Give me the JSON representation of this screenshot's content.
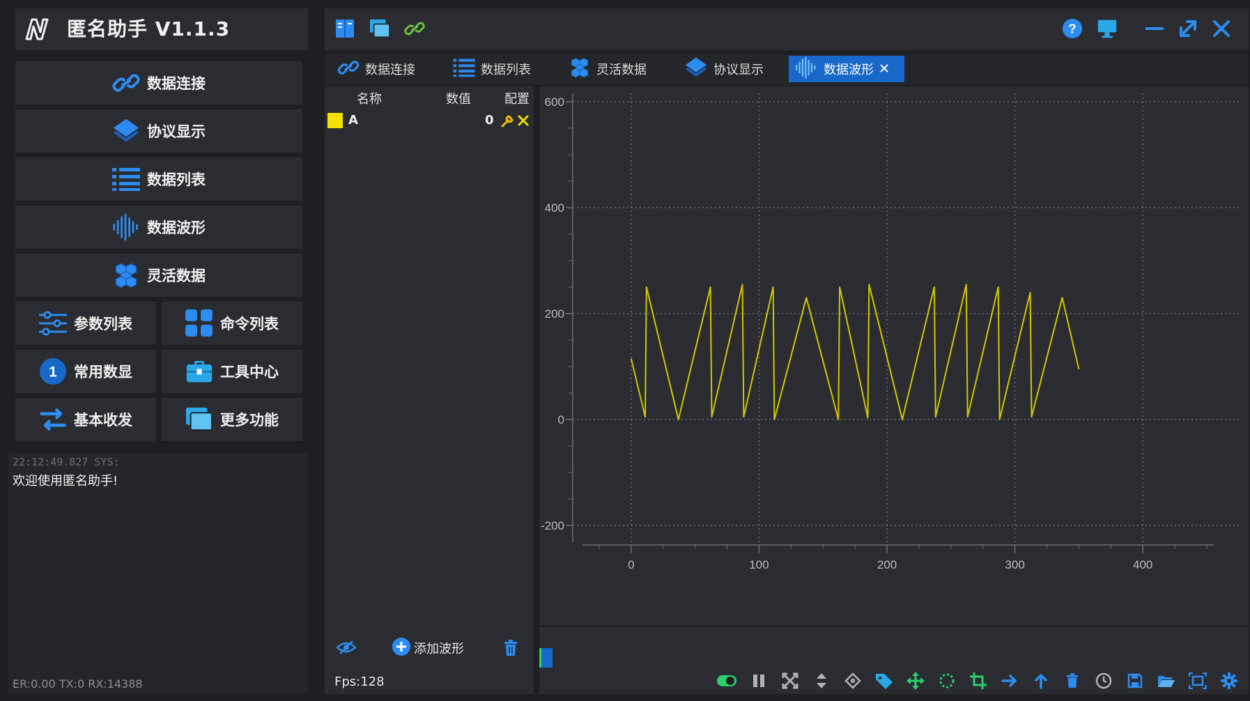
{
  "app": {
    "title": "匿名助手   V1.1.3"
  },
  "nav": {
    "connect": "数据连接",
    "protocol": "协议显示",
    "list": "数据列表",
    "waveform": "数据波形",
    "flex": "灵活数据",
    "params": "参数列表",
    "commands": "命令列表",
    "numeric": "常用数显",
    "numeric_badge": "1",
    "tools": "工具中心",
    "basic": "基本收发",
    "more": "更多功能"
  },
  "log": {
    "time": "22:12:49.827 SYS:",
    "message": "欢迎使用匿名助手!"
  },
  "status": {
    "text": "ER:0.00 TX:0 RX:14388"
  },
  "tabs": [
    {
      "label": "数据连接",
      "icon": "link-icon"
    },
    {
      "label": "数据列表",
      "icon": "list-icon"
    },
    {
      "label": "灵活数据",
      "icon": "cubes-icon"
    },
    {
      "label": "协议显示",
      "icon": "layers-icon"
    },
    {
      "label": "数据波形",
      "icon": "waveform-icon",
      "active": true
    }
  ],
  "series_table": {
    "headers": {
      "name": "名称",
      "value": "数值",
      "config": "配置"
    },
    "rows": [
      {
        "name": "A",
        "value": "0",
        "color": "#f5e000"
      }
    ]
  },
  "series_panel": {
    "add_label": "添加波形",
    "fps": "Fps:128"
  },
  "colors": {
    "accent": "#1868c9",
    "wave": "#d4c700",
    "background": "#1d1f23",
    "panel": "#2a2c31"
  },
  "chart_data": {
    "type": "line",
    "xlim": [
      -50,
      450
    ],
    "ylim": [
      -250,
      620
    ],
    "x_ticks": [
      0,
      100,
      200,
      300,
      400
    ],
    "y_ticks": [
      -200,
      0,
      200,
      400,
      600
    ],
    "grid": true,
    "series": [
      {
        "color": "#d4c700",
        "x": [
          0,
          11,
          12,
          37,
          62,
          63,
          87,
          88,
          111,
          112,
          137,
          162,
          163,
          185,
          186,
          212,
          237,
          238,
          262,
          263,
          287,
          288,
          312,
          313,
          337,
          350
        ],
        "y": [
          115,
          5,
          250,
          0,
          250,
          5,
          255,
          5,
          250,
          0,
          230,
          0,
          250,
          3,
          255,
          0,
          250,
          5,
          255,
          5,
          250,
          0,
          240,
          5,
          230,
          95
        ]
      }
    ]
  }
}
